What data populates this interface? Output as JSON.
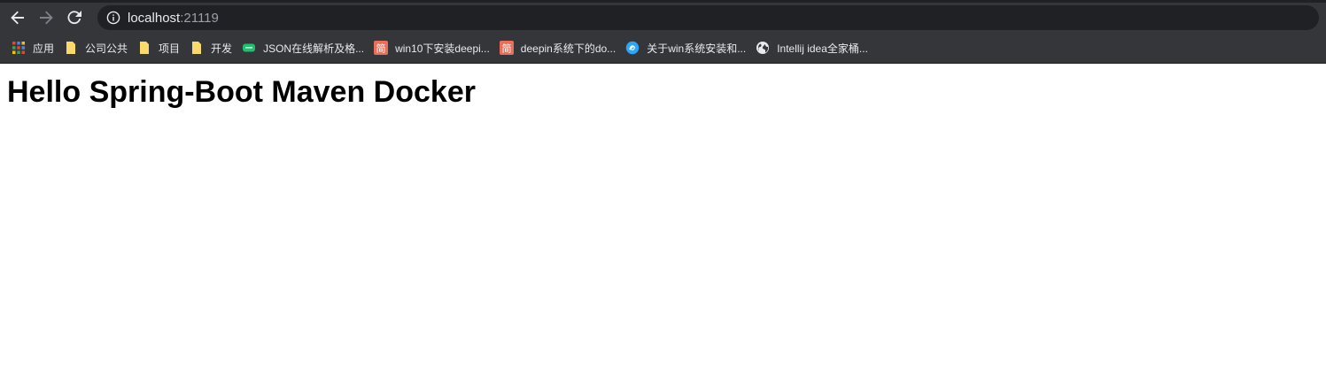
{
  "toolbar": {
    "url_host": "localhost",
    "url_port": ":21119"
  },
  "bookmarks": [
    {
      "label": "应用",
      "icon": "apps-grid-icon"
    },
    {
      "label": "公司公共",
      "icon": "folder-icon"
    },
    {
      "label": "项目",
      "icon": "folder-icon"
    },
    {
      "label": "开发",
      "icon": "folder-icon"
    },
    {
      "label": "JSON在线解析及格...",
      "icon": "json-icon"
    },
    {
      "label": "win10下安装deepi...",
      "icon": "jianshu-icon"
    },
    {
      "label": "deepin系统下的do...",
      "icon": "jianshu-icon"
    },
    {
      "label": "关于win系统安装和...",
      "icon": "deepin-icon"
    },
    {
      "label": "Intellij idea全家桶...",
      "icon": "globe-icon"
    }
  ],
  "page": {
    "heading": "Hello Spring-Boot Maven Docker"
  },
  "colors": {
    "toolbar_bg": "#35363a",
    "omnibox_bg": "#202124",
    "folder": "#f9d96a",
    "jianshu": "#ea6f5a",
    "json": "#1fbf6d"
  }
}
